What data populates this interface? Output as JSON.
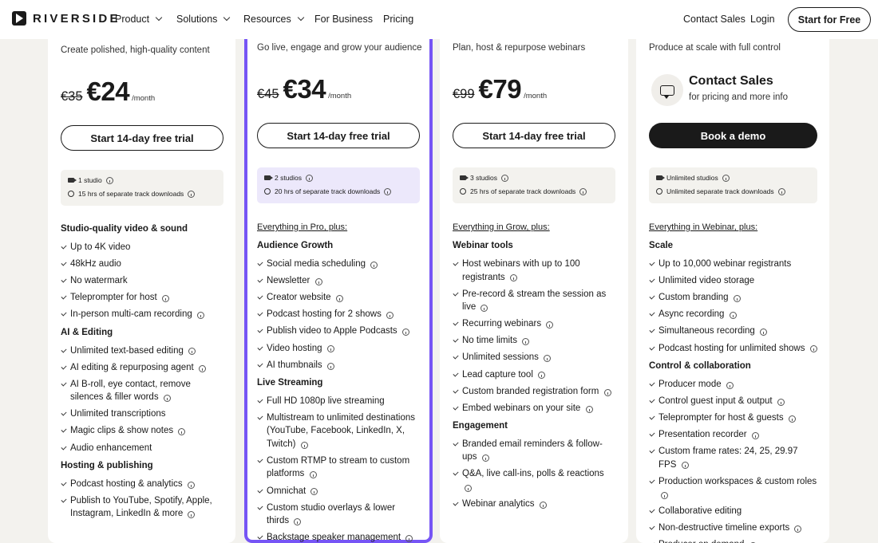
{
  "nav": {
    "brand": "RIVERSIDE",
    "items": [
      "Product",
      "Solutions",
      "Resources",
      "For Business",
      "Pricing"
    ],
    "contact": "Contact Sales",
    "login": "Login",
    "start": "Start for Free"
  },
  "plans": [
    {
      "subtitle": "Create polished, high-quality content",
      "old_price": "€35",
      "price": "€24",
      "per": "/month",
      "cta": "Start 14-day free trial",
      "studios": "1 studio",
      "hours": "15 hrs of separate track downloads",
      "everything": "",
      "groups": [
        {
          "title": "Studio-quality video & sound",
          "items": [
            "Up to 4K video",
            "48kHz audio",
            "No watermark",
            "Teleprompter for host",
            "In-person multi-cam recording"
          ]
        },
        {
          "title": "AI & Editing",
          "items": [
            "Unlimited text-based editing",
            "AI editing & repurposing agent",
            "AI B-roll, eye contact, remove silences & filler words",
            "Unlimited transcriptions",
            "Magic clips & show notes",
            "Audio enhancement"
          ]
        },
        {
          "title": "Hosting & publishing",
          "items": [
            "Podcast hosting & analytics",
            "Publish to YouTube, Spotify, Apple, Instagram, LinkedIn & more"
          ]
        }
      ]
    },
    {
      "subtitle": "Go live, engage and grow your audience",
      "old_price": "€45",
      "price": "€34",
      "per": "/month",
      "cta": "Start 14-day free trial",
      "studios": "2 studios",
      "hours": "20 hrs of separate track downloads",
      "everything": "Everything in Pro, plus:",
      "groups": [
        {
          "title": "Audience Growth",
          "items": [
            "Social media scheduling",
            "Newsletter",
            "Creator website",
            "Podcast hosting for 2 shows",
            "Publish video to Apple Podcasts",
            "Video hosting",
            "AI thumbnails"
          ]
        },
        {
          "title": "Live Streaming",
          "items": [
            "Full HD 1080p live streaming",
            "Multistream to unlimited destinations (YouTube, Facebook, LinkedIn, X, Twitch)",
            "Custom RTMP to stream to custom platforms",
            "Omnichat",
            "Custom studio overlays & lower thirds",
            "Backstage speaker management"
          ]
        }
      ]
    },
    {
      "subtitle": "Plan, host & repurpose webinars",
      "old_price": "€99",
      "price": "€79",
      "per": "/month",
      "cta": "Start 14-day free trial",
      "studios": "3 studios",
      "hours": "25 hrs of separate track downloads",
      "everything": "Everything in Grow, plus:",
      "groups": [
        {
          "title": "Webinar tools",
          "items": [
            "Host webinars with up to 100 registrants",
            "Pre-record & stream the session as live",
            "Recurring webinars",
            "No time limits",
            "Unlimited sessions",
            "Lead capture tool",
            "Custom branded registration form",
            "Embed webinars on your site"
          ]
        },
        {
          "title": "Engagement",
          "items": [
            "Branded email reminders & follow-ups",
            "Q&A, live call-ins, polls & reactions",
            "Webinar analytics"
          ]
        }
      ]
    },
    {
      "subtitle": "Produce at scale with full control",
      "contact_title": "Contact Sales",
      "contact_sub": "for pricing and more info",
      "cta": "Book a demo",
      "studios": "Unlimited studios",
      "hours": "Unlimited separate track downloads",
      "everything": "Everything in Webinar, plus:",
      "groups": [
        {
          "title": "Scale",
          "items": [
            "Up to 10,000 webinar registrants",
            "Unlimited video storage",
            "Custom branding",
            "Async recording",
            "Simultaneous recording",
            "Podcast hosting for unlimited shows"
          ]
        },
        {
          "title": "Control & collaboration",
          "items": [
            "Producer mode",
            "Control guest input & output",
            "Teleprompter for host & guests",
            "Presentation recorder",
            "Custom frame rates: 24, 25, 29.97 FPS",
            "Production workspaces & custom roles",
            "Collaborative editing",
            "Non-destructive timeline exports",
            "Producer on demand"
          ]
        }
      ]
    }
  ]
}
